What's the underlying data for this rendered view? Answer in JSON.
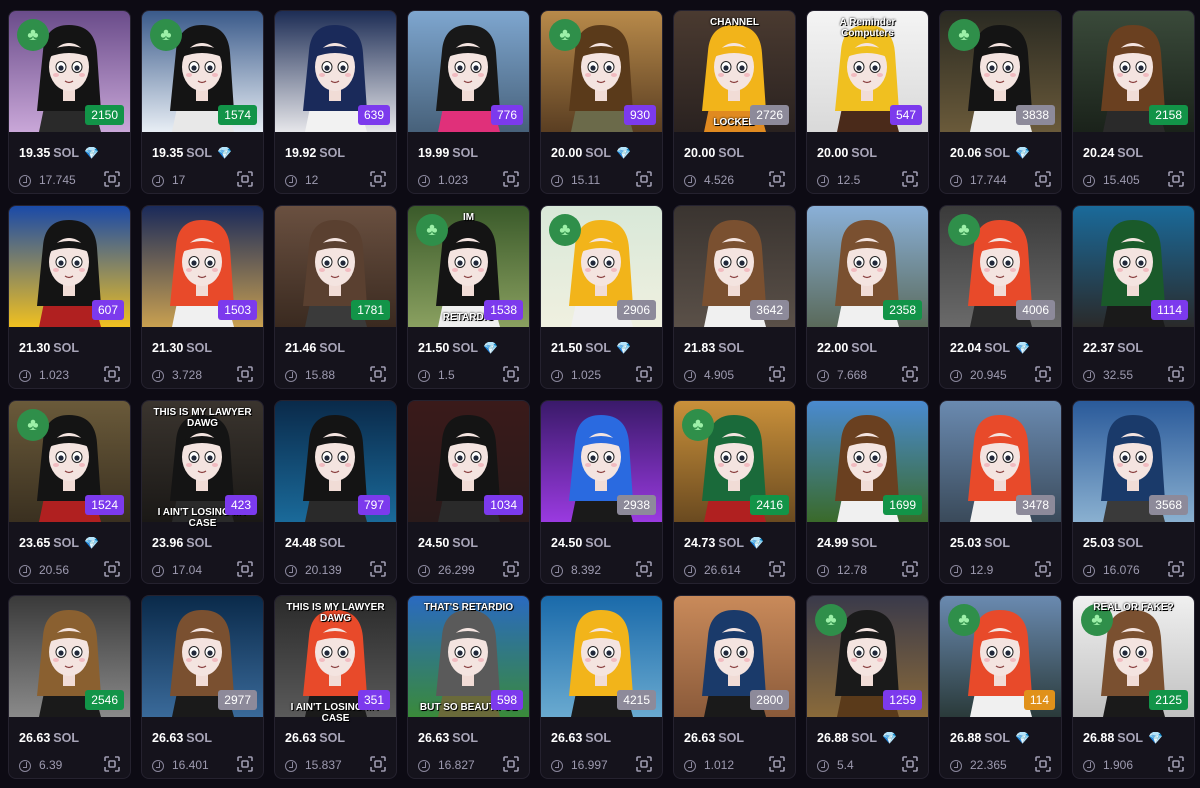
{
  "currency": "SOL",
  "colors": {
    "rank_purple": "#7c3aed",
    "rank_green": "#129448",
    "rank_gray": "#8d8a9a",
    "rank_orange": "#e0911a",
    "clover_bg": "#2f8f4a",
    "gem": "#b48cff"
  },
  "icons": [
    "clover-icon",
    "gem-icon",
    "last-sale-icon",
    "scan-icon"
  ],
  "cards": [
    {
      "rank": "2150",
      "rank_color": "green",
      "price": "19.35",
      "gem": true,
      "last": "17.745",
      "clover": true,
      "bg": [
        "#6a4c8a",
        "#c9a7d8"
      ],
      "hair": "#141414",
      "shirt": "#2a2a2a",
      "caption_top": "",
      "caption_bottom": ""
    },
    {
      "rank": "1574",
      "rank_color": "green",
      "price": "19.35",
      "gem": true,
      "last": "17",
      "clover": true,
      "bg": [
        "#3a5a8a",
        "#e8eef5"
      ],
      "hair": "#141414",
      "shirt": "#e8e8e8",
      "caption_top": "",
      "caption_bottom": ""
    },
    {
      "rank": "639",
      "rank_color": "purple",
      "price": "19.92",
      "gem": false,
      "last": "12",
      "clover": false,
      "bg": [
        "#1d2d55",
        "#e6e6ea"
      ],
      "hair": "#1a2a5a",
      "shirt": "#f2f2f2",
      "caption_top": "",
      "caption_bottom": ""
    },
    {
      "rank": "776",
      "rank_color": "purple",
      "price": "19.99",
      "gem": false,
      "last": "1.023",
      "clover": false,
      "bg": [
        "#7ea6cf",
        "#47617a"
      ],
      "hair": "#181818",
      "shirt": "#e0307a",
      "caption_top": "",
      "caption_bottom": ""
    },
    {
      "rank": "930",
      "rank_color": "purple",
      "price": "20.00",
      "gem": true,
      "last": "15.11",
      "clover": true,
      "bg": [
        "#b88a4a",
        "#5a3e22"
      ],
      "hair": "#5a3a1a",
      "shirt": "#6b6a4a",
      "caption_top": "",
      "caption_bottom": ""
    },
    {
      "rank": "2726",
      "rank_color": "gray",
      "price": "20.00",
      "gem": false,
      "last": "4.526",
      "clover": false,
      "bg": [
        "#4a3a30",
        "#2a2220"
      ],
      "hair": "#f2b41a",
      "shirt": "#e08a20",
      "caption_top": "CHANNEL",
      "caption_bottom": "LOCKED"
    },
    {
      "rank": "547",
      "rank_color": "purple",
      "price": "20.00",
      "gem": false,
      "last": "12.5",
      "clover": false,
      "bg": [
        "#f4f4f4",
        "#d9d9d9"
      ],
      "hair": "#f0c020",
      "shirt": "#4a2a1a",
      "caption_top": "A Reminder Computers",
      "caption_bottom": ""
    },
    {
      "rank": "3838",
      "rank_color": "gray",
      "price": "20.06",
      "gem": true,
      "last": "17.744",
      "clover": true,
      "bg": [
        "#2a2a22",
        "#6a5a3a"
      ],
      "hair": "#141414",
      "shirt": "#eeeeee",
      "caption_top": "",
      "caption_bottom": ""
    },
    {
      "rank": "2158",
      "rank_color": "green",
      "price": "20.24",
      "gem": false,
      "last": "15.405",
      "clover": false,
      "bg": [
        "#3a4a3a",
        "#1a221a"
      ],
      "hair": "#6a4020",
      "shirt": "#2a2a2a",
      "caption_top": "",
      "caption_bottom": ""
    },
    {
      "rank": "607",
      "rank_color": "purple",
      "price": "21.30",
      "gem": false,
      "last": "1.023",
      "clover": false,
      "bg": [
        "#1a4aa8",
        "#f0c020"
      ],
      "hair": "#141414",
      "shirt": "#b02020",
      "caption_top": "",
      "caption_bottom": ""
    },
    {
      "rank": "1503",
      "rank_color": "purple",
      "price": "21.30",
      "gem": false,
      "last": "3.728",
      "clover": false,
      "bg": [
        "#1a2a5a",
        "#c9a050"
      ],
      "hair": "#e84a2a",
      "shirt": "#f0f0f0",
      "caption_top": "",
      "caption_bottom": ""
    },
    {
      "rank": "1781",
      "rank_color": "green",
      "price": "21.46",
      "gem": false,
      "last": "15.88",
      "clover": false,
      "bg": [
        "#6a5040",
        "#3a2a20"
      ],
      "hair": "#5a4030",
      "shirt": "#3a3a3a",
      "caption_top": "",
      "caption_bottom": ""
    },
    {
      "rank": "1538",
      "rank_color": "purple",
      "price": "21.50",
      "gem": true,
      "last": "1.5",
      "clover": true,
      "bg": [
        "#3a5a2a",
        "#8aa060"
      ],
      "hair": "#141414",
      "shirt": "#f0f0f0",
      "caption_top": "IM",
      "caption_bottom": "RETARDIO"
    },
    {
      "rank": "2906",
      "rank_color": "gray",
      "price": "21.50",
      "gem": true,
      "last": "1.025",
      "clover": true,
      "bg": [
        "#d8e8d8",
        "#f0f0e0"
      ],
      "hair": "#f2b41a",
      "shirt": "#f0f0f0",
      "caption_top": "",
      "caption_bottom": ""
    },
    {
      "rank": "3642",
      "rank_color": "gray",
      "price": "21.83",
      "gem": false,
      "last": "4.905",
      "clover": false,
      "bg": [
        "#3a3430",
        "#5a5048"
      ],
      "hair": "#7a5030",
      "shirt": "#f0f0f0",
      "caption_top": "",
      "caption_bottom": ""
    },
    {
      "rank": "2358",
      "rank_color": "green",
      "price": "22.00",
      "gem": false,
      "last": "7.668",
      "clover": false,
      "bg": [
        "#8ab0d8",
        "#5a6a5a"
      ],
      "hair": "#7a5030",
      "shirt": "#f0f0f0",
      "caption_top": "",
      "caption_bottom": ""
    },
    {
      "rank": "4006",
      "rank_color": "gray",
      "price": "22.04",
      "gem": true,
      "last": "20.945",
      "clover": true,
      "bg": [
        "#3a3a3a",
        "#6a6a6a"
      ],
      "hair": "#e84a2a",
      "shirt": "#2a2a2a",
      "caption_top": "",
      "caption_bottom": ""
    },
    {
      "rank": "1114",
      "rank_color": "purple",
      "price": "22.37",
      "gem": false,
      "last": "32.55",
      "clover": false,
      "bg": [
        "#1a6a9a",
        "#2a2a2a"
      ],
      "hair": "#1a5a2a",
      "shirt": "#1a1a1a",
      "caption_top": "",
      "caption_bottom": ""
    },
    {
      "rank": "1524",
      "rank_color": "purple",
      "price": "23.65",
      "gem": true,
      "last": "20.56",
      "clover": true,
      "bg": [
        "#6a5a3a",
        "#3a3020"
      ],
      "hair": "#141414",
      "shirt": "#b02020",
      "caption_top": "",
      "caption_bottom": ""
    },
    {
      "rank": "423",
      "rank_color": "purple",
      "price": "23.96",
      "gem": false,
      "last": "17.04",
      "clover": false,
      "bg": [
        "#3a342e",
        "#1a1816"
      ],
      "hair": "#141414",
      "shirt": "#2a2a2a",
      "caption_top": "THIS IS MY LAWYER DAWG",
      "caption_bottom": "I AIN'T LOSING MY CASE"
    },
    {
      "rank": "797",
      "rank_color": "purple",
      "price": "24.48",
      "gem": false,
      "last": "20.139",
      "clover": false,
      "bg": [
        "#0a2a4a",
        "#1a6a9a"
      ],
      "hair": "#141414",
      "shirt": "#2a2a2a",
      "caption_top": "",
      "caption_bottom": ""
    },
    {
      "rank": "1034",
      "rank_color": "purple",
      "price": "24.50",
      "gem": false,
      "last": "26.299",
      "clover": false,
      "bg": [
        "#3a1a1a",
        "#2a1a1a"
      ],
      "hair": "#141414",
      "shirt": "#2a2a2a",
      "caption_top": "",
      "caption_bottom": ""
    },
    {
      "rank": "2938",
      "rank_color": "gray",
      "price": "24.50",
      "gem": false,
      "last": "8.392",
      "clover": false,
      "bg": [
        "#3a1a6a",
        "#9a3ae0"
      ],
      "hair": "#2a6ae0",
      "shirt": "#1a1a1a",
      "caption_top": "",
      "caption_bottom": ""
    },
    {
      "rank": "2416",
      "rank_color": "green",
      "price": "24.73",
      "gem": true,
      "last": "26.614",
      "clover": true,
      "bg": [
        "#c9903a",
        "#6a4a20"
      ],
      "hair": "#1a6a3a",
      "shirt": "#b02020",
      "caption_top": "",
      "caption_bottom": ""
    },
    {
      "rank": "1699",
      "rank_color": "green",
      "price": "24.99",
      "gem": false,
      "last": "12.78",
      "clover": false,
      "bg": [
        "#4a8ad0",
        "#3a6a2a"
      ],
      "hair": "#6a4020",
      "shirt": "#f0f0f0",
      "caption_top": "",
      "caption_bottom": ""
    },
    {
      "rank": "3478",
      "rank_color": "gray",
      "price": "25.03",
      "gem": false,
      "last": "12.9",
      "clover": false,
      "bg": [
        "#6a8ab0",
        "#3a4a5a"
      ],
      "hair": "#e84a2a",
      "shirt": "#f0f0f0",
      "caption_top": "",
      "caption_bottom": ""
    },
    {
      "rank": "3568",
      "rank_color": "gray",
      "price": "25.03",
      "gem": false,
      "last": "16.076",
      "clover": false,
      "bg": [
        "#2a5a9a",
        "#8ab0d0"
      ],
      "hair": "#1a3a6a",
      "shirt": "#3a3a3a",
      "caption_top": "",
      "caption_bottom": ""
    },
    {
      "rank": "2546",
      "rank_color": "green",
      "price": "26.63",
      "gem": false,
      "last": "6.39",
      "clover": false,
      "bg": [
        "#3a3a3a",
        "#8a8a8a"
      ],
      "hair": "#8a6030",
      "shirt": "#1a1a1a",
      "caption_top": "",
      "caption_bottom": ""
    },
    {
      "rank": "2977",
      "rank_color": "gray",
      "price": "26.63",
      "gem": false,
      "last": "16.401",
      "clover": false,
      "bg": [
        "#0a2a4a",
        "#3a6a9a"
      ],
      "hair": "#7a5030",
      "shirt": "#1a1a1a",
      "caption_top": "",
      "caption_bottom": ""
    },
    {
      "rank": "351",
      "rank_color": "purple",
      "price": "26.63",
      "gem": false,
      "last": "15.837",
      "clover": false,
      "bg": [
        "#2a2a2a",
        "#5a5a5a"
      ],
      "hair": "#e84a2a",
      "shirt": "#1a1a1a",
      "caption_top": "THIS IS MY LAWYER DAWG",
      "caption_bottom": "I AIN'T LOSING MY CASE"
    },
    {
      "rank": "598",
      "rank_color": "purple",
      "price": "26.63",
      "gem": false,
      "last": "16.827",
      "clover": false,
      "bg": [
        "#2a6ac0",
        "#3a8a3a"
      ],
      "hair": "#5a5a5a",
      "shirt": "#6a6a3a",
      "caption_top": "THAT'S RETARDIO",
      "caption_bottom": "BUT SO BEAUTIFUL"
    },
    {
      "rank": "4215",
      "rank_color": "gray",
      "price": "26.63",
      "gem": false,
      "last": "16.997",
      "clover": false,
      "bg": [
        "#1a6aaa",
        "#6aaad0"
      ],
      "hair": "#f2b41a",
      "shirt": "#1a1a1a",
      "caption_top": "",
      "caption_bottom": ""
    },
    {
      "rank": "2800",
      "rank_color": "gray",
      "price": "26.63",
      "gem": false,
      "last": "1.012",
      "clover": false,
      "bg": [
        "#c98a5a",
        "#8a5a3a"
      ],
      "hair": "#1a3a6a",
      "shirt": "#1a1a1a",
      "caption_top": "",
      "caption_bottom": ""
    },
    {
      "rank": "1259",
      "rank_color": "purple",
      "price": "26.88",
      "gem": true,
      "last": "5.4",
      "clover": true,
      "bg": [
        "#3a3a4a",
        "#8a6a3a"
      ],
      "hair": "#1a1a1a",
      "shirt": "#5a3a1a",
      "caption_top": "",
      "caption_bottom": ""
    },
    {
      "rank": "114",
      "rank_color": "orange",
      "price": "26.88",
      "gem": true,
      "last": "22.365",
      "clover": true,
      "bg": [
        "#6a8ab0",
        "#2a3a3a"
      ],
      "hair": "#e84a2a",
      "shirt": "#f0f0f0",
      "caption_top": "",
      "caption_bottom": ""
    },
    {
      "rank": "2125",
      "rank_color": "green",
      "price": "26.88",
      "gem": true,
      "last": "1.906",
      "clover": true,
      "bg": [
        "#f0f0f0",
        "#c0c0c0"
      ],
      "hair": "#7a5030",
      "shirt": "#1a1a1a",
      "caption_top": "REAL OR FAKE?",
      "caption_bottom": ""
    }
  ]
}
